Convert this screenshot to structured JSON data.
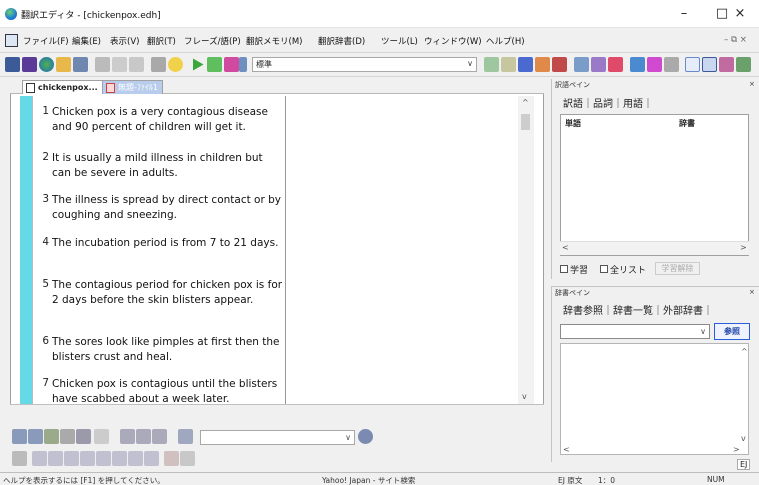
{
  "window": {
    "title": "翻訳エディタ - [chickenpox.edh]",
    "controls": [
      "–",
      "□",
      "×"
    ]
  },
  "menu": {
    "items": [
      "ファイル(F)",
      "編集(E)",
      "表示(V)",
      "翻訳(T)",
      "フレーズ/語(P)",
      "翻訳メモリ(M)",
      "翻訳辞書(D)",
      "ツール(L)",
      "ウィンドウ(W)",
      "ヘルプ(H)"
    ],
    "mdi_controls": "– ⧉ ×"
  },
  "toolbar": {
    "style_select_value": "標準"
  },
  "doc": {
    "tabs": [
      {
        "label": "chickenpox..."
      },
      {
        "label": "無題-ﾌｧｲﾙ1"
      }
    ],
    "segments": [
      {
        "num": "1",
        "text": "Chicken pox is a very contagious disease and 90 percent of children will get it."
      },
      {
        "num": "2",
        "text": "It is usually a mild illness in children but can be severe in adults."
      },
      {
        "num": "3",
        "text": "The illness is spread by direct contact or by coughing and sneezing."
      },
      {
        "num": "4",
        "text": "The incubation period is from 7 to 21 days."
      },
      {
        "num": "5",
        "text": "The contagious period for chicken pox is for 2 days before the skin blisters appear."
      },
      {
        "num": "6",
        "text": "The sores look like pimples at first then the blisters crust and heal."
      },
      {
        "num": "7",
        "text": "Chicken pox is contagious until the blisters have scabbed about a week later."
      }
    ]
  },
  "pane1": {
    "caption": "訳語ペイン",
    "tabs": "訳語｜品詞｜用語｜",
    "col_word": "単語",
    "col_dict": "辞書",
    "check_learn": "学習",
    "check_all": "全リスト",
    "learn_release": "学習解除"
  },
  "pane2": {
    "caption": "辞書ペイン",
    "tabs": "辞書参照｜辞書一覧｜外部辞書｜",
    "ref_button": "参照",
    "ej": "EJ"
  },
  "status": {
    "help": "ヘルプを表示するには [F1] を押してください。",
    "search": "Yahoo! Japan - サイト検索",
    "mode": "EJ 原文",
    "pos": "1：0",
    "num": "NUM"
  },
  "colors": {
    "stripe": "#66d9e6",
    "active_tab": "#ffffff",
    "inactive_tab": "#b8ccec",
    "accent_button_border": "#2b5fd9"
  }
}
